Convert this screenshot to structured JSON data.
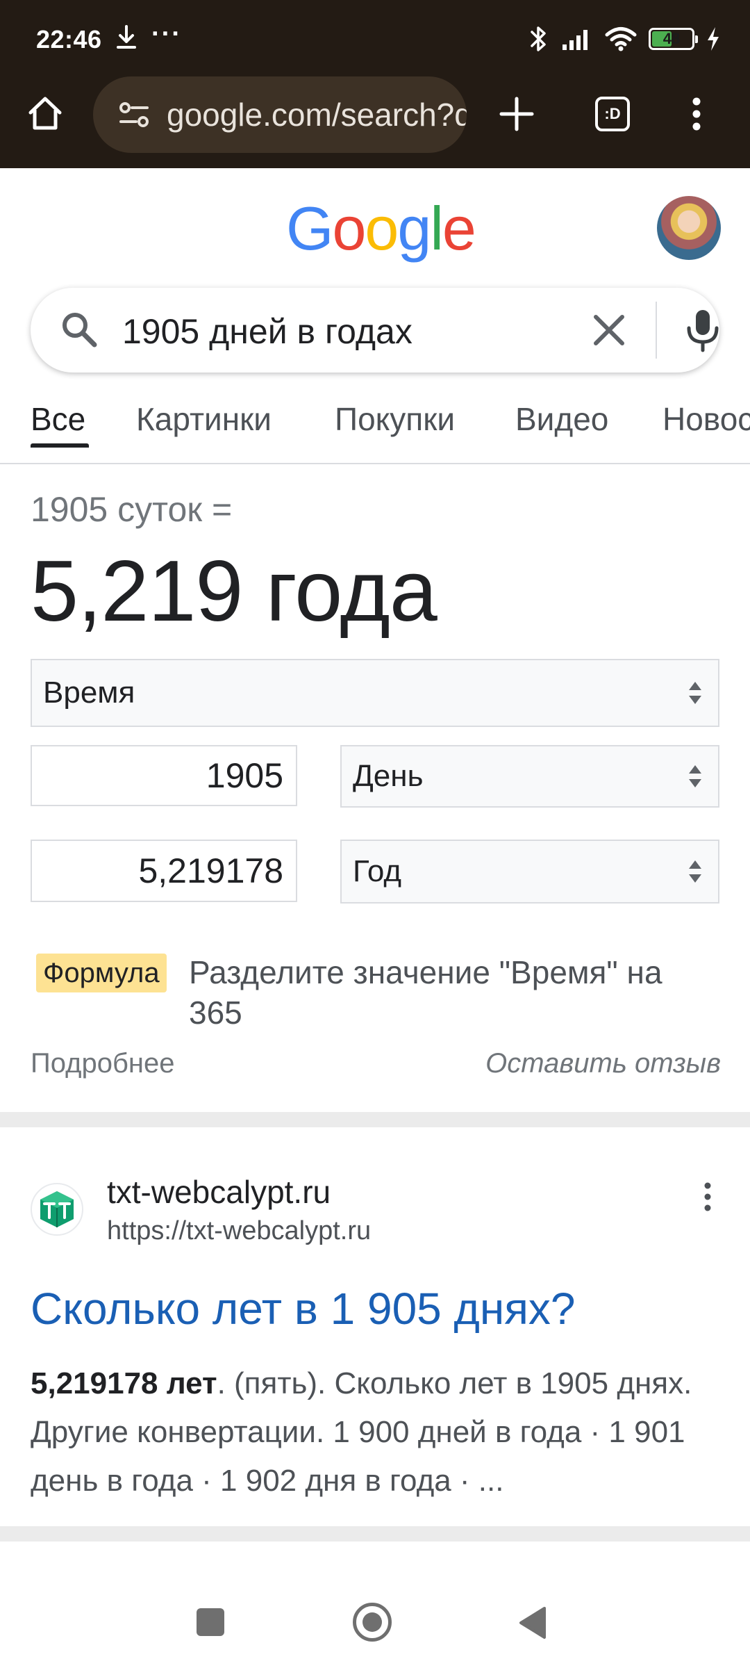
{
  "status_bar": {
    "time": "22:46",
    "more": "···",
    "battery_level": "48",
    "icons": [
      "download-icon",
      "bluetooth-icon",
      "signal-icon",
      "wifi-icon",
      "battery-icon",
      "charging-icon"
    ]
  },
  "browser": {
    "url": "google.com/search?q",
    "icons": [
      "home-icon",
      "site-settings-icon",
      "new-tab-icon",
      "tab-switcher-icon",
      "overflow-menu-icon"
    ],
    "tab_switcher_label": ":D"
  },
  "google": {
    "logo_letters": [
      "G",
      "o",
      "o",
      "g",
      "l",
      "e"
    ],
    "logo_colors": [
      "#4285f4",
      "#ea4335",
      "#fbbc05",
      "#4285f4",
      "#34a853",
      "#ea4335"
    ]
  },
  "search": {
    "query": "1905 дней в годах"
  },
  "tabs": [
    {
      "label": "Все",
      "active": true
    },
    {
      "label": "Картинки"
    },
    {
      "label": "Покупки"
    },
    {
      "label": "Видео"
    },
    {
      "label": "Новости"
    }
  ],
  "converter": {
    "subtitle": "1905 суток =",
    "result": "5,219 года",
    "quantity": "Время",
    "from_value": "1905",
    "from_unit": "День",
    "to_value": "5,219178",
    "to_unit": "Год",
    "formula_label": "Формула",
    "formula_text": "Разделите значение \"Время\" на 365",
    "more_link": "Подробнее",
    "feedback_link": "Оставить отзыв"
  },
  "result": {
    "site_name": "txt-webcalypt.ru",
    "site_url": "https://txt-webcalypt.ru",
    "title": "Сколько лет в 1 905 днях?",
    "snippet_bold": "5,219178 лет",
    "snippet_rest": ". (пять). Сколько лет в 1905 днях. Другие конвертации. 1 900 дней в года · 1 901 день в года · 1 902 дня в года · ..."
  },
  "colors": {
    "chrome_bg": "#231b14",
    "url_bar_bg": "#3d3125",
    "link_blue": "#1a5fb4",
    "formula_badge": "#fde293",
    "battery_green": "#4caf50"
  }
}
